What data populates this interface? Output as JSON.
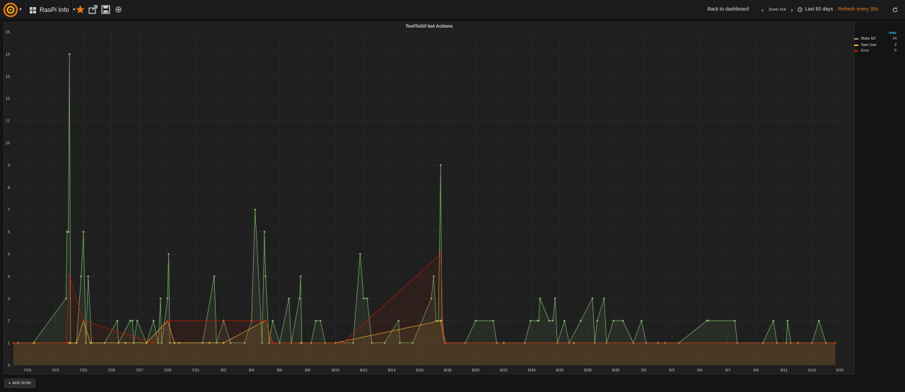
{
  "topbar": {
    "dashboard_title": "RasPi Info",
    "back_label": "Back to dashboard",
    "zoom_label": "Zoom Out",
    "time_range": "Last 60 days",
    "refresh_label": "Refresh every 30s",
    "icons": [
      "grafana-logo-icon",
      "dashboard-grid-icon",
      "star-icon",
      "share-icon",
      "save-icon",
      "gear-icon",
      "chevron-left-icon",
      "chevron-right-icon",
      "clock-icon",
      "refresh-icon"
    ],
    "colors": {
      "star": "#eb7b18",
      "refresh": "#eb7b18"
    }
  },
  "panel": {
    "title": "TextToGif bot Actions"
  },
  "legend": {
    "header": "max",
    "items": [
      {
        "name": "Make Gif",
        "max": "14",
        "color": "#7eb26d"
      },
      {
        "name": "New User",
        "max": "2",
        "color": "#eab839"
      },
      {
        "name": "Error",
        "max": "5",
        "color": "#bf1b00"
      }
    ]
  },
  "footer": {
    "add_row_label": "ADD ROW"
  },
  "chart_data": {
    "type": "line",
    "title": "TextToGif bot Actions",
    "xlabel": "",
    "ylabel": "",
    "x_range": [
      "2017-07-18",
      "2017-09-15"
    ],
    "ylim": [
      0,
      15
    ],
    "grid": true,
    "legend_position": "right",
    "x_ticks": [
      "7/19",
      "7/21",
      "7/23",
      "7/25",
      "7/27",
      "7/29",
      "7/31",
      "8/2",
      "8/4",
      "8/6",
      "8/8",
      "8/10",
      "8/12",
      "8/14",
      "8/16",
      "8/18",
      "8/20",
      "8/22",
      "8/24",
      "8/26",
      "8/28",
      "8/30",
      "9/1",
      "9/3",
      "9/5",
      "9/7",
      "9/9",
      "9/11",
      "9/13",
      "9/15"
    ],
    "y_ticks": [
      0,
      1,
      2,
      3,
      4,
      5,
      6,
      7,
      8,
      9,
      10,
      11,
      12,
      13,
      14,
      15
    ],
    "series": [
      {
        "name": "Make Gif",
        "color": "#7eb26d",
        "points": [
          [
            "2017-07-18T00:00",
            1
          ],
          [
            "2017-07-18T08:00",
            1
          ],
          [
            "2017-07-19T10:00",
            1
          ],
          [
            "2017-07-21T18:00",
            3
          ],
          [
            "2017-07-21T20:00",
            6
          ],
          [
            "2017-07-21T22:00",
            6
          ],
          [
            "2017-07-22T00:00",
            14
          ],
          [
            "2017-07-22T02:00",
            1
          ],
          [
            "2017-07-22T12:00",
            1
          ],
          [
            "2017-07-22T20:00",
            4
          ],
          [
            "2017-07-23T00:00",
            6
          ],
          [
            "2017-07-23T04:00",
            1
          ],
          [
            "2017-07-23T08:00",
            4
          ],
          [
            "2017-07-23T14:00",
            1
          ],
          [
            "2017-07-24T12:00",
            1
          ],
          [
            "2017-07-25T10:00",
            2
          ],
          [
            "2017-07-25T12:00",
            1
          ],
          [
            "2017-07-26T08:00",
            2
          ],
          [
            "2017-07-26T12:00",
            2
          ],
          [
            "2017-07-26T14:00",
            1
          ],
          [
            "2017-07-26T20:00",
            2
          ],
          [
            "2017-07-27T12:00",
            1
          ],
          [
            "2017-07-28T00:00",
            2
          ],
          [
            "2017-07-28T08:00",
            1
          ],
          [
            "2017-07-28T12:00",
            3
          ],
          [
            "2017-07-28T14:00",
            1
          ],
          [
            "2017-07-29T00:00",
            3
          ],
          [
            "2017-07-29T02:00",
            5
          ],
          [
            "2017-07-29T04:00",
            1
          ],
          [
            "2017-07-29T20:00",
            1
          ],
          [
            "2017-07-31T12:00",
            1
          ],
          [
            "2017-08-01T08:00",
            4
          ],
          [
            "2017-08-01T12:00",
            1
          ],
          [
            "2017-08-02T00:00",
            2
          ],
          [
            "2017-08-02T12:00",
            1
          ],
          [
            "2017-08-03T12:00",
            1
          ],
          [
            "2017-08-04T00:00",
            2
          ],
          [
            "2017-08-04T06:00",
            7
          ],
          [
            "2017-08-04T18:00",
            1
          ],
          [
            "2017-08-04T22:00",
            6
          ],
          [
            "2017-08-05T00:00",
            4
          ],
          [
            "2017-08-05T06:00",
            1
          ],
          [
            "2017-08-05T12:00",
            2
          ],
          [
            "2017-08-06T00:00",
            1
          ],
          [
            "2017-08-06T16:00",
            3
          ],
          [
            "2017-08-06T20:00",
            1
          ],
          [
            "2017-08-07T10:00",
            3
          ],
          [
            "2017-08-07T12:00",
            4
          ],
          [
            "2017-08-07T14:00",
            1
          ],
          [
            "2017-08-08T06:00",
            1
          ],
          [
            "2017-08-08T14:00",
            2
          ],
          [
            "2017-08-08T22:00",
            2
          ],
          [
            "2017-08-09T06:00",
            1
          ],
          [
            "2017-08-10T12:00",
            1
          ],
          [
            "2017-08-11T06:00",
            1
          ],
          [
            "2017-08-11T18:00",
            5
          ],
          [
            "2017-08-12T00:00",
            3
          ],
          [
            "2017-08-12T06:00",
            3
          ],
          [
            "2017-08-12T14:00",
            1
          ],
          [
            "2017-08-13T12:00",
            1
          ],
          [
            "2017-08-14T12:00",
            2
          ],
          [
            "2017-08-14T14:00",
            1
          ],
          [
            "2017-08-15T12:00",
            1
          ],
          [
            "2017-08-16T20:00",
            3
          ],
          [
            "2017-08-17T00:00",
            4
          ],
          [
            "2017-08-17T04:00",
            2
          ],
          [
            "2017-08-17T08:00",
            2
          ],
          [
            "2017-08-17T12:00",
            9
          ],
          [
            "2017-08-17T14:00",
            2
          ],
          [
            "2017-08-17T20:00",
            1
          ],
          [
            "2017-08-19T06:00",
            1
          ],
          [
            "2017-08-20T00:00",
            2
          ],
          [
            "2017-08-21T06:00",
            2
          ],
          [
            "2017-08-21T12:00",
            1
          ],
          [
            "2017-08-23T12:00",
            1
          ],
          [
            "2017-08-23T22:00",
            2
          ],
          [
            "2017-08-24T10:00",
            2
          ],
          [
            "2017-08-24T12:00",
            2
          ],
          [
            "2017-08-24T14:00",
            3
          ],
          [
            "2017-08-25T06:00",
            2
          ],
          [
            "2017-08-25T12:00",
            2
          ],
          [
            "2017-08-25T16:00",
            3
          ],
          [
            "2017-08-25T20:00",
            1
          ],
          [
            "2017-08-26T08:00",
            2
          ],
          [
            "2017-08-26T16:00",
            1
          ],
          [
            "2017-08-27T12:00",
            2
          ],
          [
            "2017-08-28T08:00",
            3
          ],
          [
            "2017-08-28T12:00",
            1
          ],
          [
            "2017-08-28T16:00",
            2
          ],
          [
            "2017-08-29T04:00",
            3
          ],
          [
            "2017-08-29T08:00",
            1
          ],
          [
            "2017-08-29T20:00",
            2
          ],
          [
            "2017-08-30T12:00",
            2
          ],
          [
            "2017-08-31T06:00",
            1
          ],
          [
            "2017-08-31T20:00",
            2
          ],
          [
            "2017-09-01T04:00",
            1
          ],
          [
            "2017-09-02T12:00",
            1
          ],
          [
            "2017-09-03T12:00",
            1
          ],
          [
            "2017-09-05T12:00",
            2
          ],
          [
            "2017-09-05T14:00",
            2
          ],
          [
            "2017-09-07T12:00",
            2
          ],
          [
            "2017-09-07T16:00",
            1
          ],
          [
            "2017-09-09T12:00",
            1
          ],
          [
            "2017-09-10T06:00",
            2
          ],
          [
            "2017-09-10T12:00",
            1
          ],
          [
            "2017-09-11T04:00",
            1
          ],
          [
            "2017-09-11T06:00",
            2
          ],
          [
            "2017-09-11T12:00",
            1
          ],
          [
            "2017-09-13T00:00",
            1
          ],
          [
            "2017-09-13T12:00",
            2
          ],
          [
            "2017-09-14T00:00",
            1
          ],
          [
            "2017-09-14T16:00",
            1
          ]
        ]
      },
      {
        "name": "New User",
        "color": "#eab839",
        "points": [
          [
            "2017-07-18T00:00",
            1
          ],
          [
            "2017-07-19T12:00",
            1
          ],
          [
            "2017-07-22T00:00",
            1
          ],
          [
            "2017-07-22T12:00",
            1
          ],
          [
            "2017-07-23T00:00",
            2
          ],
          [
            "2017-07-23T12:00",
            1
          ],
          [
            "2017-07-26T00:00",
            1
          ],
          [
            "2017-07-27T12:00",
            1
          ],
          [
            "2017-07-29T00:00",
            2
          ],
          [
            "2017-07-29T12:00",
            1
          ],
          [
            "2017-08-01T00:00",
            1
          ],
          [
            "2017-08-02T00:00",
            1
          ],
          [
            "2017-08-05T00:00",
            2
          ],
          [
            "2017-08-05T12:00",
            1
          ],
          [
            "2017-08-07T12:00",
            1
          ],
          [
            "2017-08-10T00:00",
            1
          ],
          [
            "2017-08-17T12:00",
            2
          ],
          [
            "2017-08-17T18:00",
            1
          ],
          [
            "2017-08-22T00:00",
            1
          ],
          [
            "2017-08-27T00:00",
            1
          ],
          [
            "2017-09-02T00:00",
            1
          ],
          [
            "2017-09-07T00:00",
            1
          ],
          [
            "2017-09-12T00:00",
            1
          ],
          [
            "2017-09-14T16:00",
            1
          ]
        ]
      },
      {
        "name": "Error",
        "color": "#bf1b00",
        "points": [
          [
            "2017-07-18T00:00",
            1
          ],
          [
            "2017-07-21T18:00",
            1
          ],
          [
            "2017-07-22T00:00",
            4
          ],
          [
            "2017-07-23T00:00",
            2
          ],
          [
            "2017-07-28T00:00",
            1
          ],
          [
            "2017-07-29T00:00",
            2
          ],
          [
            "2017-08-05T00:00",
            2
          ],
          [
            "2017-08-05T12:00",
            1
          ],
          [
            "2017-08-10T12:00",
            1
          ],
          [
            "2017-08-17T12:00",
            5
          ],
          [
            "2017-08-17T18:00",
            1
          ],
          [
            "2017-09-07T00:00",
            1
          ],
          [
            "2017-09-14T16:00",
            1
          ]
        ]
      }
    ]
  }
}
